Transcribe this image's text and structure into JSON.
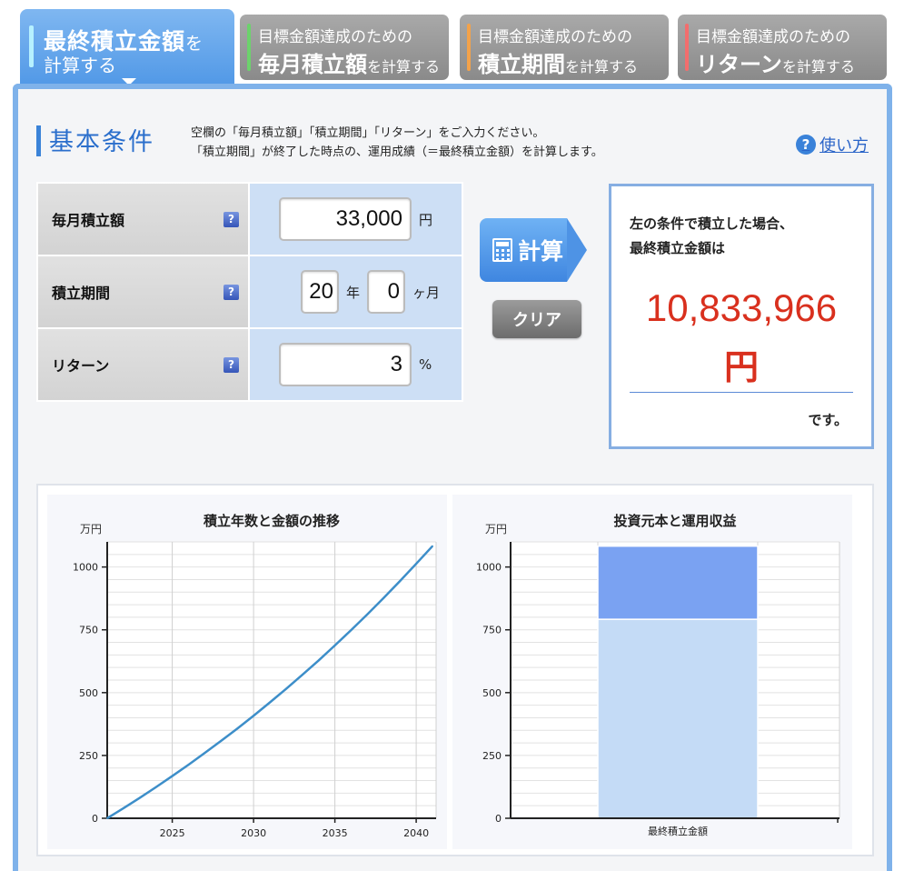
{
  "tabs": [
    {
      "line1": "最終積立金額",
      "line1_small": "を",
      "line2": "計算する",
      "active": true
    },
    {
      "line1": "目標金額達成のための",
      "line2": "毎月積立額",
      "line2_small": "を計算する",
      "bar_color": "#6cd26c"
    },
    {
      "line1": "目標金額達成のための",
      "line2": "積立期間",
      "line2_small": "を計算する",
      "bar_color": "#f3a24a"
    },
    {
      "line1": "目標金額達成のための",
      "line2": "リターン",
      "line2_small": "を計算する",
      "bar_color": "#f36d6d"
    }
  ],
  "section": {
    "title": "基本条件",
    "desc_line1": "空欄の「毎月積立額」「積立期間」「リターン」をご入力ください。",
    "desc_line2": "「積立期間」が終了した時点の、運用成績（＝最終積立金額）を計算します。",
    "help_label": "使い方"
  },
  "form": {
    "monthly_label": "毎月積立額",
    "monthly_value": "33,000",
    "monthly_unit": "円",
    "period_label": "積立期間",
    "period_years": "20",
    "years_unit": "年",
    "period_months": "0",
    "months_unit": "ヶ月",
    "return_label": "リターン",
    "return_value": "3",
    "return_unit": "%",
    "help_mark": "?"
  },
  "buttons": {
    "calc_label": "計算",
    "clear_label": "クリア"
  },
  "result": {
    "line1": "左の条件で積立した場合、",
    "line2": "最終積立金額は",
    "amount": "10,833,966",
    "yen": "円",
    "suffix": "です。"
  },
  "colors": {
    "accent": "#4f97e6",
    "result_red": "#d9301e",
    "principal": "#c4dbf6",
    "profit": "#7aa2f2",
    "line": "#3d8ec9"
  },
  "chart_data": [
    {
      "type": "line",
      "title": "積立年数と金額の推移",
      "ylabel": "万円",
      "xlabel": "",
      "x": [
        2021,
        2022,
        2023,
        2024,
        2025,
        2026,
        2027,
        2028,
        2029,
        2030,
        2031,
        2032,
        2033,
        2034,
        2035,
        2036,
        2037,
        2038,
        2039,
        2040,
        2041
      ],
      "series": [
        {
          "values": [
            0,
            40,
            81,
            124,
            168,
            213,
            260,
            308,
            357,
            408,
            461,
            515,
            571,
            628,
            688,
            749,
            812,
            877,
            944,
            1013,
            1083
          ]
        }
      ],
      "xlim": [
        2021,
        2041
      ],
      "ylim": [
        0,
        1100
      ],
      "xticks": [
        2025,
        2030,
        2035,
        2040
      ],
      "yticks": [
        0,
        250,
        500,
        750,
        1000
      ],
      "grid": true
    },
    {
      "type": "bar",
      "stacked": true,
      "title": "投資元本と運用収益",
      "ylabel": "万円",
      "categories": [
        "最終積立金額"
      ],
      "series": [
        {
          "values": [
            792
          ]
        },
        {
          "values": [
            291
          ]
        }
      ],
      "ylim": [
        0,
        1100
      ],
      "yticks": [
        0,
        250,
        500,
        750,
        1000
      ],
      "grid": true
    }
  ]
}
